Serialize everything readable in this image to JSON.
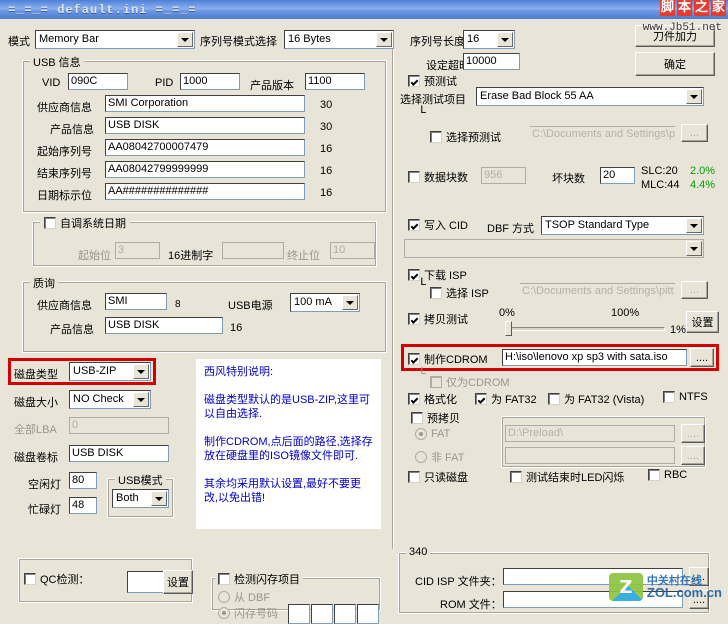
{
  "window": {
    "title": "=_=_=   default.ini   =_=_="
  },
  "watermarks": {
    "jb_chars": [
      "脚",
      "本",
      "之",
      "家"
    ],
    "jb_url": "www.Jb51.net",
    "zol_cn": "中关村在线",
    "zol_en": "ZOL.com.cn"
  },
  "top": {
    "mode_label": "模式",
    "mode_value": "Memory Bar",
    "serial_mode_label": "序列号模式选择",
    "serial_mode_value": "16 Bytes",
    "serial_len_label": "序列号长度",
    "serial_len_value": "16",
    "timeout_label": "设定超时",
    "timeout_value": "10000",
    "hidden_button": "刀件加力",
    "ok_button": "确定"
  },
  "usb_info": {
    "caption": "USB 信息",
    "vid_label": "VID",
    "vid_value": "090C",
    "pid_label": "PID",
    "pid_value": "1000",
    "rev_label": "产品版本",
    "rev_value": "1100",
    "vendor_label": "供应商信息",
    "vendor_value": "SMI Corporation",
    "vendor_len": "30",
    "product_label": "产品信息",
    "product_value": "USB DISK",
    "product_len": "30",
    "serial_start_label": "起始序列号",
    "serial_start_value": "AA08042700007479",
    "serial_start_len": "16",
    "serial_end_label": "结束序列号",
    "serial_end_value": "AA08042799999999",
    "serial_end_len": "16",
    "date_label": "日期标示位",
    "date_value": "AA##############",
    "date_len": "16"
  },
  "autodate": {
    "caption": "自调系统日期",
    "checked": false,
    "start_label": "起始位",
    "start_value": "3",
    "hex_label": "16进制字",
    "hex_value": "",
    "end_label": "终止位",
    "end_value": "10"
  },
  "inquiry": {
    "caption": "质询",
    "vendor_label": "供应商信息",
    "vendor_value": "SMI",
    "vendor_len": "8",
    "power_label": "USB电源",
    "power_value": "100 mA",
    "product_label": "产品信息",
    "product_value": "USB DISK",
    "product_len": "16"
  },
  "disk": {
    "type_label": "磁盘类型",
    "type_value": "USB-ZIP",
    "size_label": "磁盘大小",
    "size_value": "NO Check",
    "lba_label": "全部LBA",
    "lba_value": "0",
    "volume_label": "磁盘卷标",
    "volume_value": "USB DISK",
    "idle_led_label": "空闲灯",
    "idle_led_value": "80",
    "busy_led_label": "忙碌灯",
    "busy_led_value": "48",
    "usb_mode_caption": "USB模式",
    "usb_mode_value": "Both"
  },
  "note": {
    "text": "西风特别说明:\n\n磁盘类型默认的是USB-ZIP,这里可以自由选择.\n\n制作CDROM,点后面的路径,选择存放在硬盘里的ISO镜像文件即可.\n\n其余均采用默认设置,最好不要更改,以免出错!"
  },
  "test": {
    "pretest_label": "预测试",
    "pretest_checked": true,
    "item_label": "选择测试项目",
    "item_value": "Erase Bad Block 55 AA",
    "select_pretest_label": "选择预测试",
    "select_pretest_checked": false,
    "select_pretest_path": "C:\\Documents and Settings\\pit",
    "browse_label": "...",
    "datablock_label": "数据块数",
    "datablock_value": "956",
    "datablock_checked": false,
    "badblock_label": "坏块数",
    "badblock_value": "20",
    "slc_label": "SLC:20",
    "slc_pct": "2.0%",
    "mlc_label": "MLC:44",
    "mlc_pct": "4.4%"
  },
  "cid": {
    "write_cid_label": "写入 CID",
    "write_cid_checked": true,
    "dbf_label": "DBF 方式",
    "dbf_value": "TSOP Standard Type",
    "empty_combo_value": ""
  },
  "isp": {
    "download_label": "下载 ISP",
    "download_checked": true,
    "select_label": "选择 ISP",
    "select_checked": false,
    "select_path": "C:\\Documents and Settings\\pitt.ch",
    "browse_label": "..."
  },
  "copytest": {
    "label": "拷贝测试",
    "checked": true,
    "min_label": "0%",
    "max_label": "100%",
    "value_label": "1%",
    "settings_button": "设置"
  },
  "cdrom": {
    "label": "制作CDROM",
    "checked": true,
    "path": "H:\\iso\\lenovo xp sp3 with sata.iso",
    "browse_label": "....",
    "only_cdrom_label": "仅为CDROM",
    "only_cdrom_checked": false
  },
  "format": {
    "format_label": "格式化",
    "format_checked": true,
    "fat32_label": "为 FAT32",
    "fat32_checked": true,
    "fat32v_label": "为 FAT32 (Vista)",
    "fat32v_checked": false,
    "ntfs_label": "NTFS",
    "ntfs_checked": false
  },
  "precopy": {
    "caption": "预拷贝",
    "checked": false,
    "fat_label": "FAT",
    "fat_selected": true,
    "fat_path": "D:\\Preload\\",
    "nonfat_label": "非 FAT",
    "nonfat_selected": false,
    "nonfat_path": "",
    "browse_label": "...."
  },
  "misc": {
    "readonly_label": "只读磁盘",
    "readonly_checked": false,
    "led_label": "测试结束时LED闪烁",
    "led_checked": false,
    "rbc_label": "RBC",
    "rbc_checked": false
  },
  "qc": {
    "label": "QC检测：",
    "checked": false,
    "value": "",
    "settings_button": "设置"
  },
  "flash": {
    "caption": "检测闪存项目",
    "checked": false,
    "from_dbf_label": "从 DBF",
    "from_dbf_selected": false,
    "flash_no_label": "闪存号码",
    "flash_no_selected": true,
    "boxes": [
      "",
      "",
      "",
      ""
    ]
  },
  "bottom_group": {
    "caption": "340",
    "cid_isp_label": "CID ISP 文件夹：",
    "cid_isp_value": "",
    "rom_label": "ROM 文件：",
    "rom_value": "",
    "browse_label": "...."
  }
}
